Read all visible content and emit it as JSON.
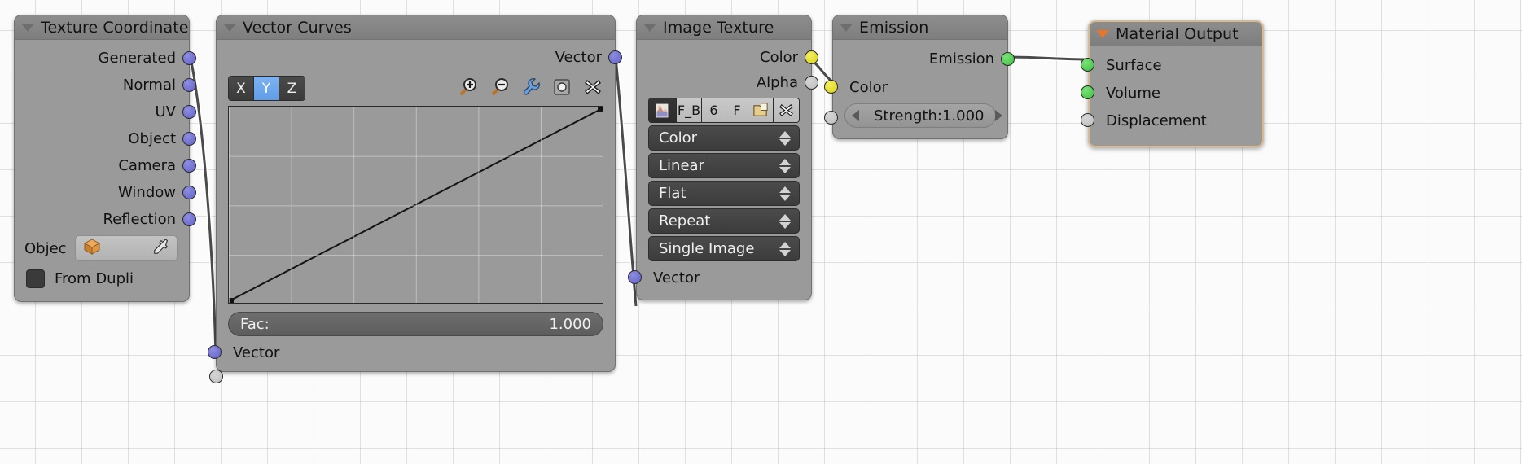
{
  "editor": {
    "name": "blender-shader-node-editor"
  },
  "nodes": {
    "texture_coordinate": {
      "title": "Texture Coordinate",
      "outputs": [
        "Generated",
        "Normal",
        "UV",
        "Object",
        "Camera",
        "Window",
        "Reflection"
      ],
      "object_label": "Objec",
      "object_icon": "cube-icon",
      "eyedropper_icon": "eyedropper-icon",
      "from_dupli_label": "From Dupli",
      "from_dupli_checked": false
    },
    "vector_curves": {
      "title": "Vector Curves",
      "axis_buttons": [
        "X",
        "Y",
        "Z"
      ],
      "axis_selected": "Y",
      "tool_icons": [
        "zoom-in-icon",
        "zoom-out-icon",
        "wrench-icon",
        "clipping-icon",
        "delete-icon"
      ],
      "fac_label": "Fac:",
      "fac_value": "1.000",
      "input_label": "Vector",
      "output_label": "Vector"
    },
    "image_texture": {
      "title": "Image Texture",
      "outputs": [
        "Color",
        "Alpha"
      ],
      "datablock": {
        "image_icon": "image-icon",
        "name": "F_B",
        "users": "6",
        "fake_user": "F",
        "open_icon": "open-folder-icon",
        "unlink_icon": "unlink-x-icon"
      },
      "dropdowns": [
        "Color",
        "Linear",
        "Flat",
        "Repeat",
        "Single Image"
      ],
      "input_label": "Vector"
    },
    "emission": {
      "title": "Emission",
      "output_label": "Emission",
      "color_label": "Color",
      "strength_label": "Strength:",
      "strength_value": "1.000"
    },
    "material_output": {
      "title": "Material Output",
      "inputs": [
        "Surface",
        "Volume",
        "Displacement"
      ],
      "active": true
    }
  },
  "colors": {
    "socket_vector": "#6c6ccc",
    "socket_value": "#c8c8c8",
    "socket_color": "#dcd418",
    "socket_shader": "#46c746",
    "node_body": "#9a9a9a",
    "node_header": "#858585",
    "active_outline": "#d6bb90",
    "axis_selected": "#5f9de8"
  }
}
